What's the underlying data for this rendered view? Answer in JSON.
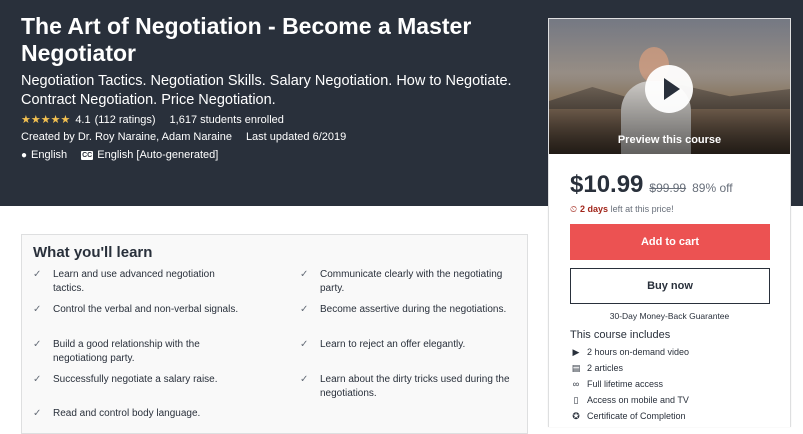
{
  "header": {
    "title": "The Art of Negotiation - Become a Master Negotiator",
    "subtitle": "Negotiation Tactics. Negotiation Skills. Salary Negotiation. How to Negotiate. Contract Negotiation. Price Negotiation.",
    "rating_stars": "★★★★★",
    "rating_value": "4.1",
    "rating_count": "(112 ratings)",
    "students": "1,617 students enrolled",
    "created_by": "Created by Dr. Roy Naraine, Adam Naraine",
    "last_updated": "Last updated 6/2019",
    "language": "English",
    "captions": "English [Auto-generated]",
    "cc_label": "CC",
    "globe_icon": "●"
  },
  "sidebar": {
    "preview_label": "Preview this course",
    "price": "$10.99",
    "original_price": "$99.99",
    "discount": "89% off",
    "timer_icon": "⏲",
    "timer_bold": "2 days",
    "timer_rest": " left at this price!",
    "add_to_cart": "Add to cart",
    "buy_now": "Buy now",
    "guarantee": "30-Day Money-Back Guarantee",
    "includes_title": "This course includes",
    "includes": [
      {
        "icon": "▶",
        "label": "2 hours on-demand video"
      },
      {
        "icon": "▤",
        "label": "2 articles"
      },
      {
        "icon": "∞",
        "label": "Full lifetime access"
      },
      {
        "icon": "▯",
        "label": "Access on mobile and TV"
      },
      {
        "icon": "✪",
        "label": "Certificate of Completion"
      }
    ]
  },
  "learn": {
    "title": "What you'll learn",
    "check": "✓",
    "left": [
      "Learn and use advanced negotiation tactics.",
      "Control the verbal and non-verbal signals.",
      "Build a good relationship with the negotiationg party.",
      "Successfully negotiate a salary raise.",
      "Read and control body language."
    ],
    "right": [
      "Communicate clearly with the negotiating party.",
      "Become assertive during the negotiations.",
      "Learn to reject an offer elegantly.",
      "Learn about the dirty tricks used during the negotiations."
    ]
  },
  "colors": {
    "hero_bg": "#29303b",
    "accent_red": "#ec5252",
    "star": "#f4c150",
    "timer_red": "#a1251a"
  }
}
